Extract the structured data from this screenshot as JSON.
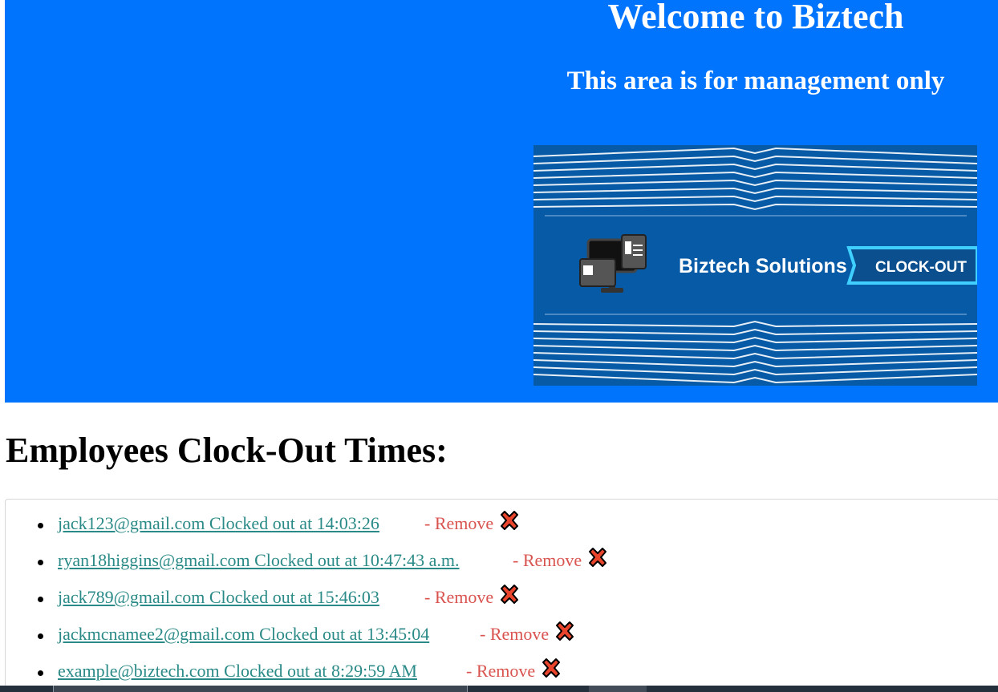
{
  "hero": {
    "title": "Welcome to Biztech",
    "subtitle": "This area is for management only",
    "background_color": "#0174fd",
    "banner": {
      "company_name": "Biztech Solutions",
      "button_label": "CLOCK-OUT",
      "icon": "computer-monitor-icon"
    }
  },
  "main": {
    "section_title": "Employees Clock-Out Times:",
    "remove_label": "- Remove",
    "remove_icon": "close-x-icon",
    "link_color": "#2a8a87",
    "remove_color": "#d9534f",
    "entries": [
      {
        "text": "jack123@gmail.com Clocked out at 14:03:26"
      },
      {
        "text": "ryan18higgins@gmail.com Clocked out at 10:47:43 a.m."
      },
      {
        "text": "jack789@gmail.com Clocked out at 15:46:03"
      },
      {
        "text": "jackmcnamee2@gmail.com Clocked out at 13:45:04"
      },
      {
        "text": "example@biztech.com Clocked out at 8:29:59 AM"
      }
    ]
  }
}
